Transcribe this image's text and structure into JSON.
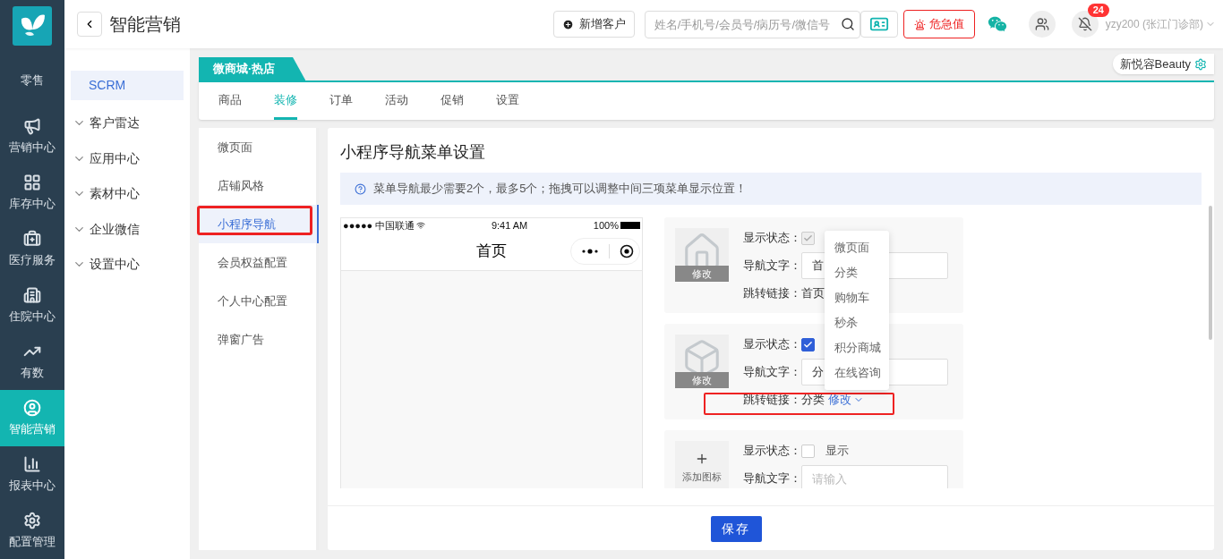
{
  "rail": {
    "items": [
      {
        "label": "零售",
        "selected": false
      },
      {
        "label": "营销中心",
        "selected": false
      },
      {
        "label": "库存中心",
        "selected": false
      },
      {
        "label": "医疗服务",
        "selected": false
      },
      {
        "label": "住院中心",
        "selected": false
      },
      {
        "label": "有数",
        "selected": false
      },
      {
        "label": "智能营销",
        "selected": true
      },
      {
        "label": "报表中心",
        "selected": false
      },
      {
        "label": "配置管理",
        "selected": false
      }
    ]
  },
  "header": {
    "title": "智能营销",
    "add_button": "新增客户",
    "search": {
      "placeholder": "姓名/手机号/会员号/病历号/微信号"
    },
    "alert_button": "危急值",
    "notification_badge": "24",
    "user": "yzy200 (张江门诊部)"
  },
  "side_menu": {
    "items": [
      {
        "label": "SCRM",
        "kind": "link",
        "selected": true
      },
      {
        "label": "客户雷达",
        "kind": "group",
        "expanded": false
      },
      {
        "label": "应用中心",
        "kind": "group",
        "expanded": false
      },
      {
        "label": "素材中心",
        "kind": "group",
        "expanded": false
      },
      {
        "label": "企业微信",
        "kind": "group",
        "expanded": false
      },
      {
        "label": "设置中心",
        "kind": "group",
        "expanded": false
      }
    ]
  },
  "store_tab": "微商城·热店",
  "store_switch": "新悦容Beauty",
  "tabs": [
    {
      "label": "商品",
      "selected": false
    },
    {
      "label": "装修",
      "selected": true
    },
    {
      "label": "订单",
      "selected": false
    },
    {
      "label": "活动",
      "selected": false
    },
    {
      "label": "促销",
      "selected": false
    },
    {
      "label": "设置",
      "selected": false
    }
  ],
  "sub_menu": [
    {
      "label": "微页面",
      "selected": false,
      "highlighted": false
    },
    {
      "label": "店铺风格",
      "selected": false,
      "highlighted": false
    },
    {
      "label": "小程序导航",
      "selected": true,
      "highlighted": true
    },
    {
      "label": "会员权益配置",
      "selected": false,
      "highlighted": false
    },
    {
      "label": "个人中心配置",
      "selected": false,
      "highlighted": false
    },
    {
      "label": "弹窗广告",
      "selected": false,
      "highlighted": false
    }
  ],
  "panel": {
    "title": "小程序导航菜单设置",
    "notice": "菜单导航最少需要2个，最多5个；拖拽可以调整中间三项菜单显示位置！",
    "preview": {
      "signal": "●●●●● 中国联通",
      "time": "9:41 AM",
      "battery": "100%",
      "page_title": "首页"
    },
    "nav_items": [
      {
        "kind": "icon",
        "icon_action": "修改",
        "status_label": "显示状态：",
        "checked": true,
        "disabled": true,
        "text_label": "导航文字：",
        "value": "首",
        "link_label": "跳转链接：",
        "link": "首页",
        "highlighted": false
      },
      {
        "kind": "icon",
        "icon_action": "修改",
        "status_label": "显示状态：",
        "checked": true,
        "disabled": false,
        "text_label": "导航文字：",
        "value": "分",
        "link_label": "跳转链接：",
        "link": "分类",
        "link_action": "修改",
        "highlighted": true
      },
      {
        "kind": "add",
        "add_label": "添加图标",
        "status_label": "显示状态：",
        "checked": false,
        "disabled": false,
        "show_label": "显示",
        "text_label": "导航文字：",
        "placeholder": "请输入"
      }
    ],
    "dropdown": {
      "options": [
        "微页面",
        "分类",
        "购物车",
        "秒杀",
        "积分商城",
        "在线咨询"
      ]
    },
    "save_button": "保存"
  }
}
